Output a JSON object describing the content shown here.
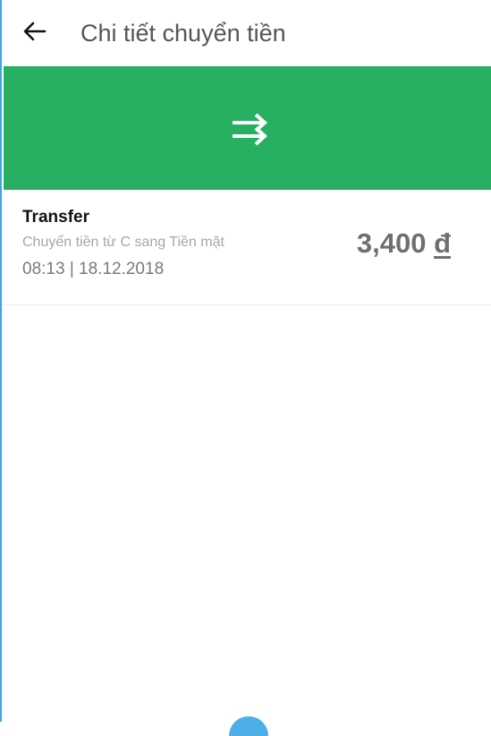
{
  "header": {
    "back_icon": "arrow-left-icon",
    "title": "Chi tiết chuyển tiền"
  },
  "banner": {
    "icon": "transfer-arrows-icon",
    "color": "#27b062"
  },
  "transaction": {
    "type": "Transfer",
    "description": "Chuyển tiền từ C sang Tiền mặt",
    "datetime": "08:13 | 18.12.2018",
    "amount": "3,400",
    "currency": "đ"
  }
}
